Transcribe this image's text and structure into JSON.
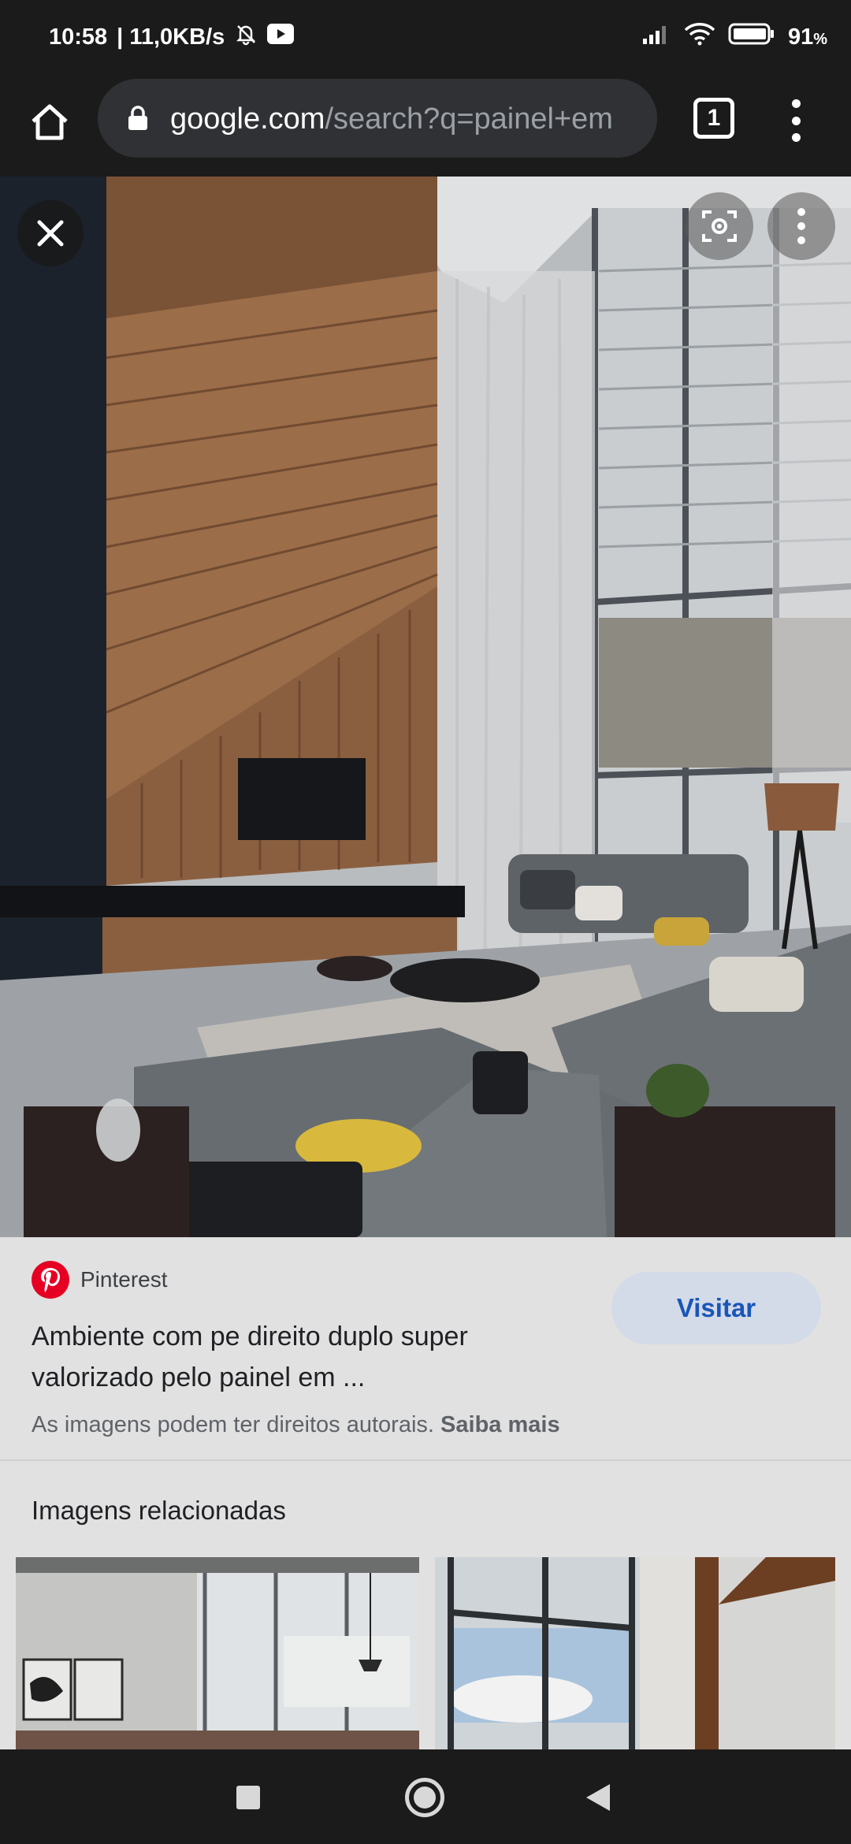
{
  "status_bar": {
    "time": "10:58",
    "net_speed": "| 11,0KB/s",
    "battery_pct": "91",
    "pct_symbol": "%"
  },
  "toolbar": {
    "url_domain": "google.com",
    "url_path": "/search?q=painel+em",
    "tab_count": "1"
  },
  "result": {
    "source": "Pinterest",
    "title": "Ambiente com pe direito duplo super valorizado pelo painel em ...",
    "visit_label": "Visitar",
    "copyright_text": "As imagens podem ter direitos autorais.",
    "learn_more": "Saiba mais"
  },
  "related": {
    "title": "Imagens relacionadas"
  },
  "colors": {
    "brand_pinterest": "#e60023",
    "visit_button_bg": "#d3dae8",
    "visit_button_text": "#1a56b8"
  }
}
